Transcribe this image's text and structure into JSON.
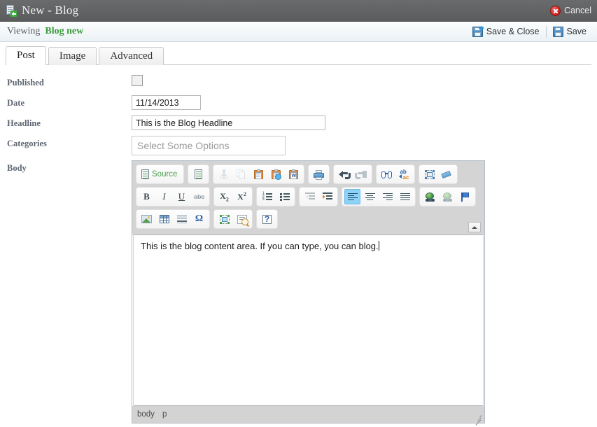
{
  "titlebar": {
    "icon": "new-document-icon",
    "title": "New - Blog",
    "cancel_label": "Cancel",
    "cancel_icon": "cancel-circle-icon",
    "background": "#5f6061"
  },
  "viewbar": {
    "viewing_label": "Viewing",
    "viewing_value": "Blog new",
    "viewing_value_color": "#3a9b3a",
    "save_close_label": "Save & Close",
    "save_label": "Save",
    "save_icon": "floppy-disk-icon"
  },
  "tabs": [
    {
      "label": "Post",
      "active": true
    },
    {
      "label": "Image",
      "active": false
    },
    {
      "label": "Advanced",
      "active": false
    }
  ],
  "form": {
    "published": {
      "label": "Published",
      "checked": false
    },
    "date": {
      "label": "Date",
      "value": "11/14/2013"
    },
    "headline": {
      "label": "Headline",
      "value": "This is the Blog Headline"
    },
    "categories": {
      "label": "Categories",
      "placeholder": "Select Some Options",
      "value": ""
    },
    "body": {
      "label": "Body"
    }
  },
  "editor": {
    "content": "This is the blog content area. If you can type, you can blog.",
    "status_path": [
      "body",
      "p"
    ],
    "collapse_icon": "collapse-toolbar-icon",
    "resize_grip": "resize-grip",
    "toolbar": {
      "rows": [
        {
          "groups": [
            {
              "buttons": [
                {
                  "name": "source-button",
                  "label": "Source",
                  "icon": "source-doc-icon",
                  "state": "normal"
                }
              ]
            },
            {
              "buttons": [
                {
                  "name": "templates-button",
                  "label": "",
                  "icon": "templates-icon",
                  "state": "normal"
                }
              ]
            },
            {
              "buttons": [
                {
                  "name": "cut-button",
                  "label": "",
                  "icon": "scissors-icon",
                  "state": "disabled"
                },
                {
                  "name": "copy-button",
                  "label": "",
                  "icon": "copy-icon",
                  "state": "disabled"
                },
                {
                  "name": "paste-button",
                  "label": "",
                  "icon": "paste-icon",
                  "state": "normal"
                },
                {
                  "name": "paste-text-button",
                  "label": "",
                  "icon": "paste-plain-text-icon",
                  "state": "normal"
                },
                {
                  "name": "paste-word-button",
                  "label": "",
                  "icon": "paste-from-word-icon",
                  "state": "normal"
                }
              ]
            },
            {
              "buttons": [
                {
                  "name": "print-button",
                  "label": "",
                  "icon": "printer-icon",
                  "state": "normal"
                }
              ]
            },
            {
              "buttons": [
                {
                  "name": "undo-button",
                  "label": "",
                  "icon": "undo-arrow-icon",
                  "state": "normal"
                },
                {
                  "name": "redo-button",
                  "label": "",
                  "icon": "redo-arrow-icon",
                  "state": "disabled"
                }
              ]
            },
            {
              "buttons": [
                {
                  "name": "find-button",
                  "label": "",
                  "icon": "binoculars-icon",
                  "state": "normal"
                },
                {
                  "name": "replace-button",
                  "label": "",
                  "icon": "replace-abc-icon",
                  "state": "normal"
                }
              ]
            },
            {
              "buttons": [
                {
                  "name": "select-all-button",
                  "label": "",
                  "icon": "select-all-icon",
                  "state": "normal"
                },
                {
                  "name": "remove-format-button",
                  "label": "",
                  "icon": "eraser-icon",
                  "state": "normal"
                }
              ]
            }
          ]
        },
        {
          "groups": [
            {
              "buttons": [
                {
                  "name": "bold-button",
                  "label": "B",
                  "icon": "bold-icon",
                  "state": "normal"
                },
                {
                  "name": "italic-button",
                  "label": "I",
                  "icon": "italic-icon",
                  "state": "normal"
                },
                {
                  "name": "underline-button",
                  "label": "U",
                  "icon": "underline-icon",
                  "state": "normal"
                },
                {
                  "name": "strikethrough-button",
                  "label": "abc",
                  "icon": "strikethrough-icon",
                  "state": "normal"
                }
              ]
            },
            {
              "buttons": [
                {
                  "name": "subscript-button",
                  "label": "X2",
                  "icon": "subscript-icon",
                  "state": "normal"
                },
                {
                  "name": "superscript-button",
                  "label": "X2",
                  "icon": "superscript-icon",
                  "state": "normal"
                }
              ]
            },
            {
              "buttons": [
                {
                  "name": "numbered-list-button",
                  "label": "",
                  "icon": "numbered-list-icon",
                  "state": "normal"
                },
                {
                  "name": "bulleted-list-button",
                  "label": "",
                  "icon": "bulleted-list-icon",
                  "state": "normal"
                }
              ]
            },
            {
              "buttons": [
                {
                  "name": "outdent-button",
                  "label": "",
                  "icon": "outdent-icon",
                  "state": "disabled"
                },
                {
                  "name": "indent-button",
                  "label": "",
                  "icon": "indent-icon",
                  "state": "normal"
                }
              ]
            },
            {
              "buttons": [
                {
                  "name": "align-left-button",
                  "label": "",
                  "icon": "align-left-icon",
                  "state": "active"
                },
                {
                  "name": "align-center-button",
                  "label": "",
                  "icon": "align-center-icon",
                  "state": "normal"
                },
                {
                  "name": "align-right-button",
                  "label": "",
                  "icon": "align-right-icon",
                  "state": "normal"
                },
                {
                  "name": "justify-button",
                  "label": "",
                  "icon": "align-justify-icon",
                  "state": "normal"
                }
              ]
            },
            {
              "buttons": [
                {
                  "name": "link-button",
                  "label": "",
                  "icon": "link-globe-icon",
                  "state": "normal"
                },
                {
                  "name": "unlink-button",
                  "label": "",
                  "icon": "unlink-globe-icon",
                  "state": "disabled"
                },
                {
                  "name": "anchor-button",
                  "label": "",
                  "icon": "anchor-flag-icon",
                  "state": "normal"
                }
              ]
            }
          ]
        },
        {
          "groups": [
            {
              "buttons": [
                {
                  "name": "image-button",
                  "label": "",
                  "icon": "image-icon",
                  "state": "normal"
                },
                {
                  "name": "table-button",
                  "label": "",
                  "icon": "table-icon",
                  "state": "normal"
                },
                {
                  "name": "horizontal-rule-button",
                  "label": "",
                  "icon": "horizontal-rule-icon",
                  "state": "normal"
                },
                {
                  "name": "special-char-button",
                  "label": "Ω",
                  "icon": "omega-special-character-icon",
                  "state": "normal"
                }
              ]
            },
            {
              "buttons": [
                {
                  "name": "maximize-button",
                  "label": "",
                  "icon": "maximize-icon",
                  "state": "normal"
                },
                {
                  "name": "show-blocks-button",
                  "label": "",
                  "icon": "show-blocks-icon",
                  "state": "normal"
                }
              ]
            },
            {
              "buttons": [
                {
                  "name": "about-button",
                  "label": "?",
                  "icon": "about-question-icon",
                  "state": "normal"
                }
              ]
            }
          ]
        }
      ]
    }
  }
}
